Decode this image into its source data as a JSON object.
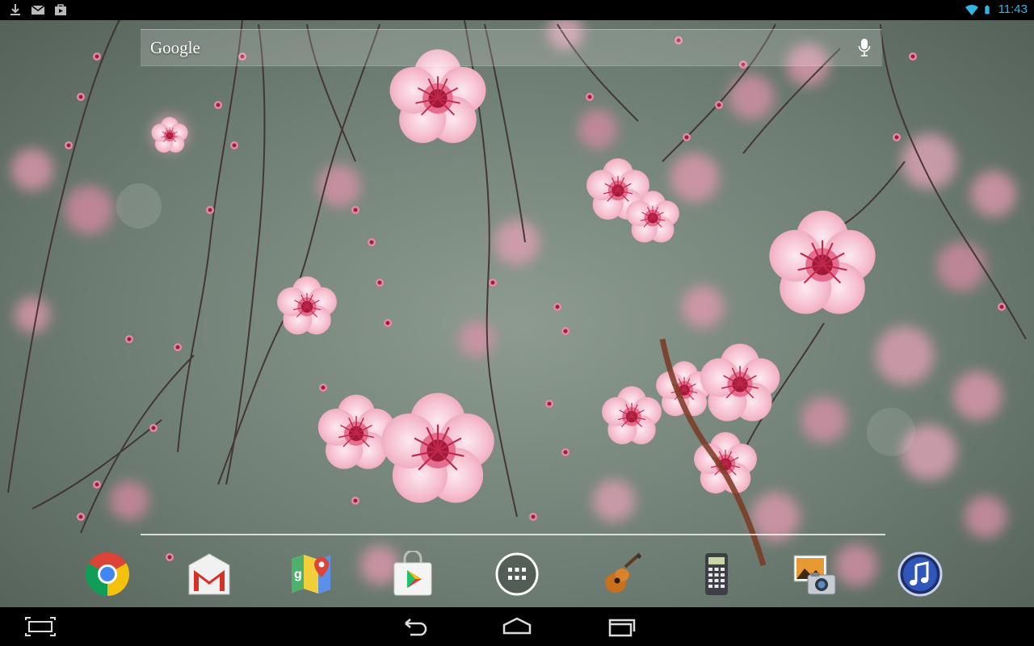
{
  "status_bar": {
    "left_icons": [
      "download-icon",
      "gmail-notification-icon",
      "play-store-notification-icon"
    ],
    "right_icons": [
      "wifi-icon",
      "battery-icon"
    ],
    "time": "11:43",
    "accent_color": "#33b5e5"
  },
  "search": {
    "logo_text": "Google",
    "icon": "mic-icon"
  },
  "dock": {
    "items": [
      {
        "icon": "chrome-icon"
      },
      {
        "icon": "gmail-icon"
      },
      {
        "icon": "maps-icon"
      },
      {
        "icon": "play-store-icon"
      },
      {
        "icon": "app-drawer-icon"
      },
      {
        "icon": "garageband-guitar-icon"
      },
      {
        "icon": "calculator-icon"
      },
      {
        "icon": "photo-camera-icon"
      },
      {
        "icon": "music-icon"
      }
    ]
  },
  "nav_bar": {
    "items": [
      {
        "icon": "screenshot-icon"
      },
      {
        "icon": "back-icon"
      },
      {
        "icon": "home-icon"
      },
      {
        "icon": "recent-apps-icon"
      }
    ]
  },
  "wallpaper": {
    "subject": "cherry-blossom",
    "colors": {
      "bg": "#6e7a70",
      "petal": "#f3b6c8",
      "center": "#b0223e"
    }
  }
}
